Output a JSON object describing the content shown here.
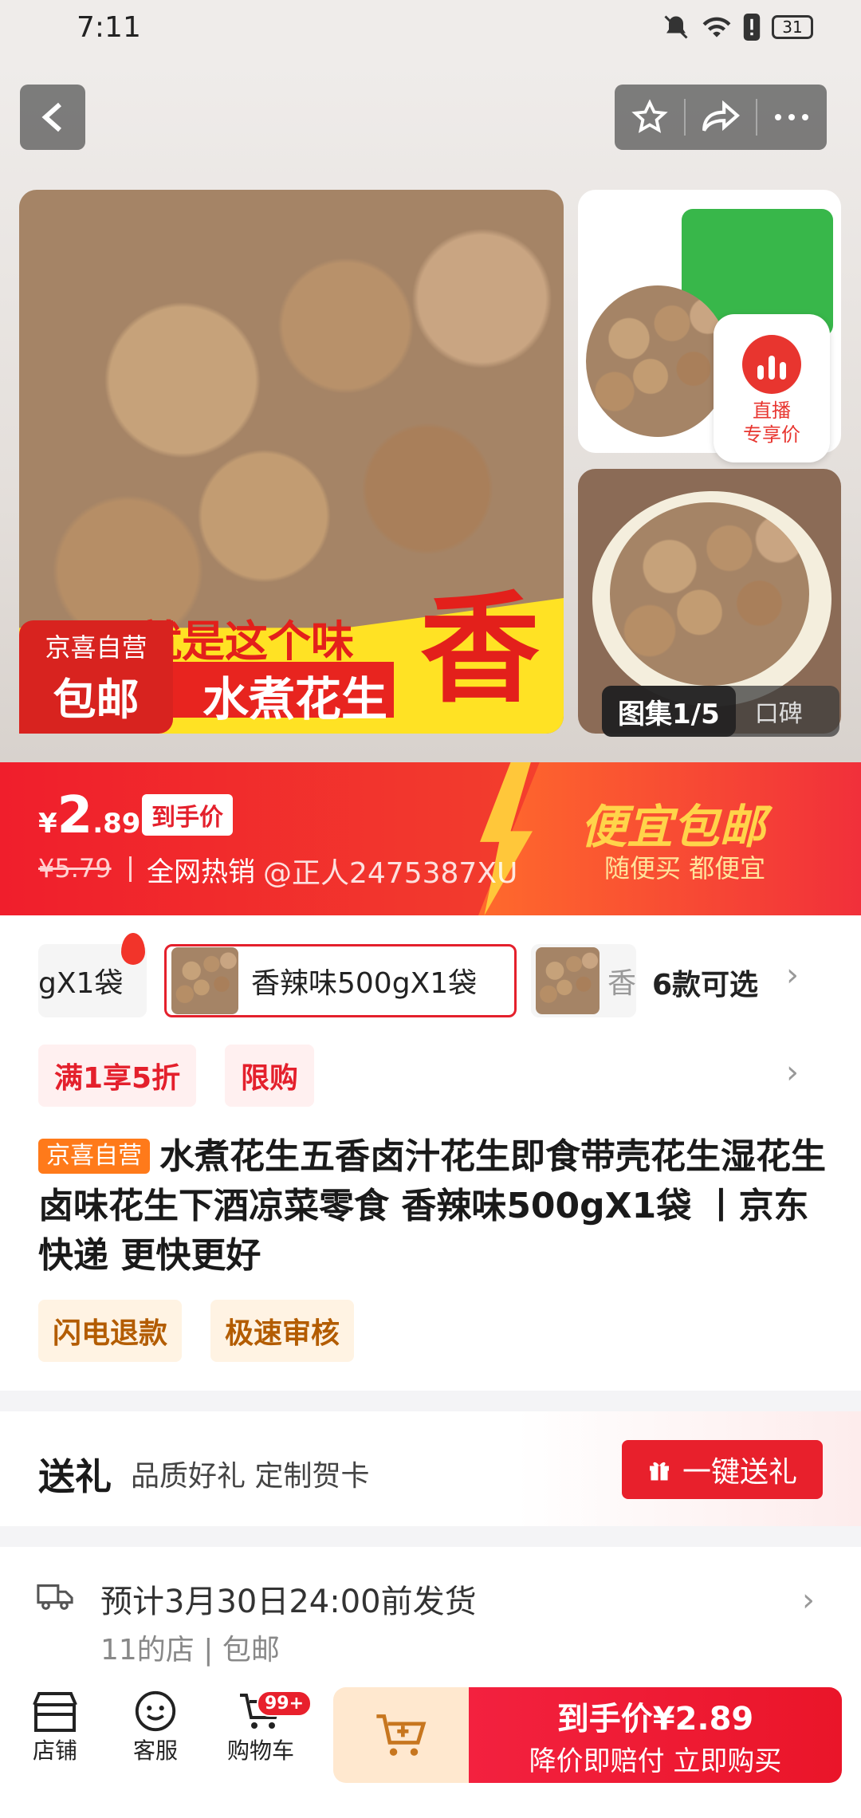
{
  "status_bar": {
    "time": "7:11",
    "battery": "31"
  },
  "gallery": {
    "banner_text1": "就是这个味",
    "banner_text2": "水煮花生",
    "big_char": "香",
    "badge_top": "京喜自营",
    "badge_bottom": "包邮",
    "live_label_1": "直播",
    "live_label_2": "专享价",
    "album_current": "图集1/5",
    "album_reviews": "口碑"
  },
  "price": {
    "currency": "¥",
    "integer": "2",
    "decimal": ".89",
    "tag": "到手价",
    "original": "¥5.79",
    "hot": "全网热销",
    "watermark": "@正人2475387XU",
    "promo_title": "便宜包邮",
    "promo_sub": "随便买 都便宜"
  },
  "skus": {
    "items": [
      {
        "label": "gX1袋"
      },
      {
        "label": "香辣味500gX1袋",
        "selected": true
      },
      {
        "label": "香"
      }
    ],
    "count_label": "6款可选"
  },
  "tags": [
    "满1享5折",
    "限购"
  ],
  "title": {
    "tag": "京喜自营",
    "text": "水煮花生五香卤汁花生即食带壳花生湿花生卤味花生下酒凉菜零食 香辣味500gX1袋 丨京东快递 更快更好"
  },
  "service_tags": [
    "闪电退款",
    "极速审核"
  ],
  "gift": {
    "title": "送礼",
    "subtitle": "品质好礼 定制贺卡",
    "button": "一键送礼"
  },
  "shipping": {
    "eta": "预计3月30日24:00前发货",
    "shop": "11的店 | 包邮"
  },
  "bottom_bar": {
    "shop": "店铺",
    "service": "客服",
    "cart": "购物车",
    "cart_badge": "99+",
    "buy_line1": "到手价¥2.89",
    "buy_line2": "降价即赔付 立即购买"
  },
  "colors": {
    "accent": "#e8202c",
    "promo_yellow": "#ffd44a"
  }
}
